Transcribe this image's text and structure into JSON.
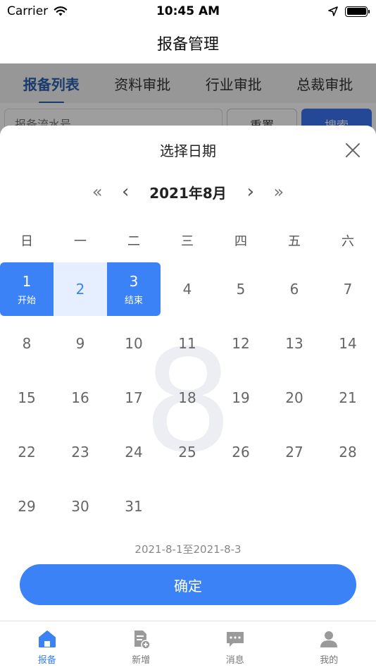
{
  "status_bar": {
    "carrier": "Carrier",
    "time": "10:45 AM"
  },
  "nav": {
    "title": "报备管理"
  },
  "page": {
    "tabs": [
      {
        "label": "报备列表",
        "active": true
      },
      {
        "label": "资料审批",
        "active": false
      },
      {
        "label": "行业审批",
        "active": false
      },
      {
        "label": "总裁审批",
        "active": false
      }
    ],
    "search_placeholder": "报备流水号",
    "reset_label": "重置",
    "search_label": "搜索"
  },
  "picker": {
    "title": "选择日期",
    "month_label": "2021年8月",
    "watermark": "8",
    "weekdays": [
      "日",
      "一",
      "二",
      "三",
      "四",
      "五",
      "六"
    ],
    "start_weekday": 0,
    "days_in_month": 31,
    "range_start": 1,
    "range_end": 3,
    "start_sub": "开始",
    "end_sub": "结束",
    "range_text": "2021-8-1至2021-8-3",
    "confirm_label": "确定",
    "accent_color": "#3b82f6",
    "range_fill_color": "#e6efff"
  },
  "tabbar": {
    "items": [
      {
        "label": "报备",
        "icon": "home-icon",
        "active": true
      },
      {
        "label": "新增",
        "icon": "document-add-icon",
        "active": false
      },
      {
        "label": "消息",
        "icon": "message-icon",
        "active": false
      },
      {
        "label": "我的",
        "icon": "user-icon",
        "active": false
      }
    ]
  }
}
